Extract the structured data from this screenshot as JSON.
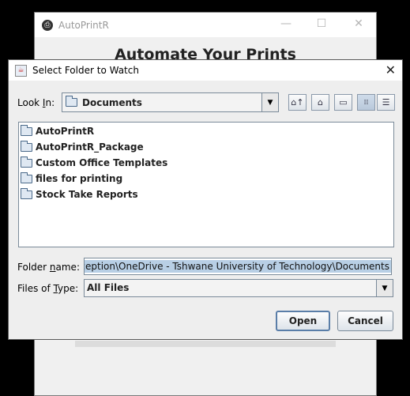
{
  "main_window": {
    "title": "AutoPrintR",
    "heading": "Automate Your Prints",
    "controls": {
      "minimize": "—",
      "maximize": "☐",
      "close": "✕"
    }
  },
  "dialog": {
    "title": "Select Folder to Watch",
    "close": "✕",
    "look_in": {
      "label_prefix": "Look ",
      "label_mnemonic": "I",
      "label_suffix": "n:",
      "value": "Documents",
      "arrow": "▼"
    },
    "toolbar": {
      "up_one_level": "up-folder-icon",
      "home": "home-icon",
      "new_folder": "new-folder-icon",
      "list_view": "list-view-icon",
      "details_view": "details-view-icon"
    },
    "files": [
      "AutoPrintR",
      "AutoPrintR_Package",
      "Custom Office Templates",
      "files for printing",
      "Stock Take Reports"
    ],
    "folder_name": {
      "label_prefix": "Folder ",
      "label_mnemonic": "n",
      "label_suffix": "ame:",
      "value": "rs\\Reception\\OneDrive - Tshwane University of Technology\\Documents"
    },
    "files_of_type": {
      "label_prefix": "Files of ",
      "label_mnemonic": "T",
      "label_suffix": "ype:",
      "value": "All Files",
      "arrow": "▼"
    },
    "buttons": {
      "open": "Open",
      "cancel": "Cancel"
    }
  },
  "colors": {
    "selection": "#b8cfe5",
    "default_button_border": "#5a7ea8"
  }
}
